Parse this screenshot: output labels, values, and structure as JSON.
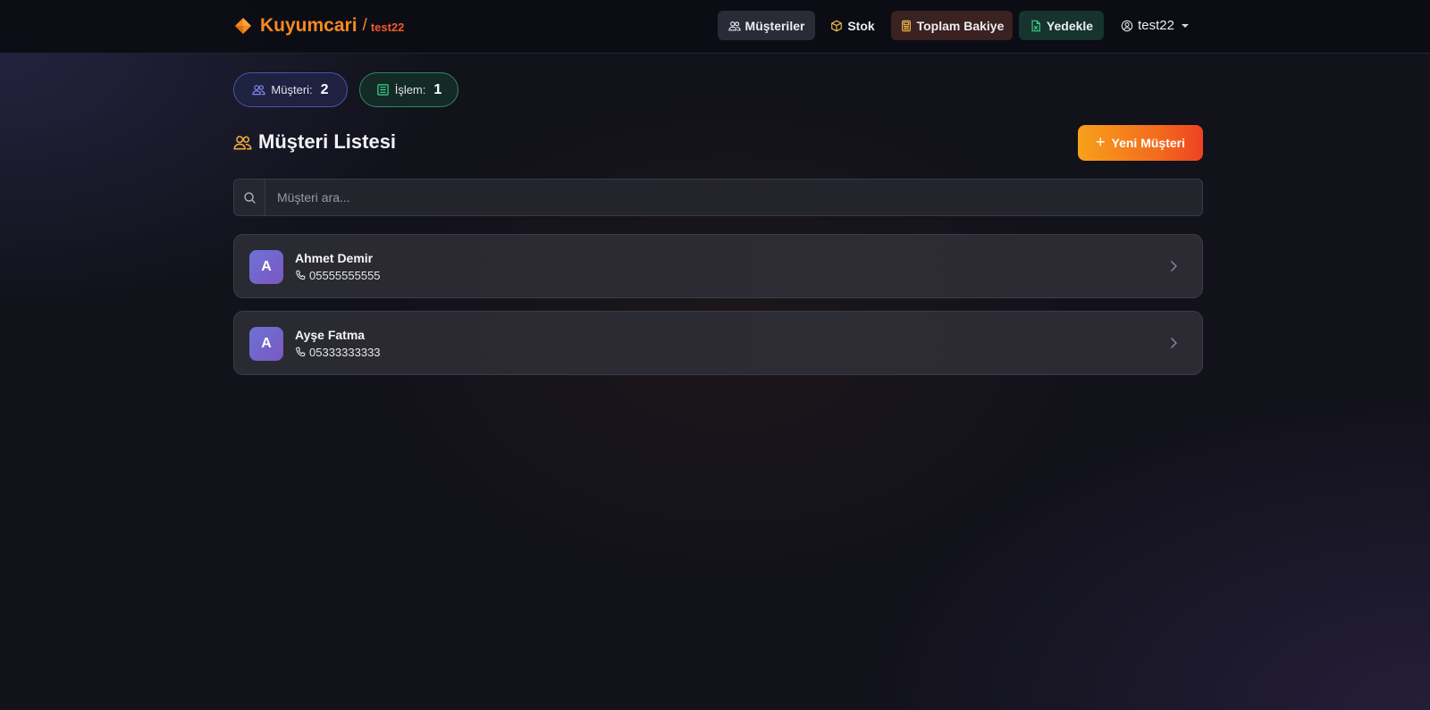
{
  "brand": {
    "title": "Kuyumcari",
    "separator": "/",
    "user": "test22"
  },
  "nav": {
    "musteriler": "Müşteriler",
    "stok": "Stok",
    "toplam_bakiye": "Toplam Bakiye",
    "yedekle": "Yedekle",
    "user": "test22"
  },
  "stats": {
    "musteri": {
      "label": "Müşteri:",
      "value": "2"
    },
    "islem": {
      "label": "İşlem:",
      "value": "1"
    }
  },
  "section": {
    "title": "Müşteri Listesi"
  },
  "new_customer_button": {
    "label": "Yeni Müşteri"
  },
  "search": {
    "placeholder": "Müşteri ara..."
  },
  "customers": [
    {
      "initial": "A",
      "name": "Ahmet Demir",
      "phone": "05555555555"
    },
    {
      "initial": "A",
      "name": "Ayşe Fatma",
      "phone": "05333333333"
    }
  ],
  "colors": {
    "brand": "#f58a1f",
    "accent_gradient_start": "#f7a11b",
    "accent_gradient_end": "#ee4220",
    "avatar": "#7265cc"
  },
  "icons": {
    "brand": "gem-icon",
    "musteriler": "people-icon",
    "stok": "box-icon",
    "toplam_bakiye": "calculator-icon",
    "yedekle": "excel-file-icon",
    "user": "user-circle-icon",
    "search": "search-icon",
    "phone": "phone-icon",
    "row": "chevron-right-icon"
  }
}
